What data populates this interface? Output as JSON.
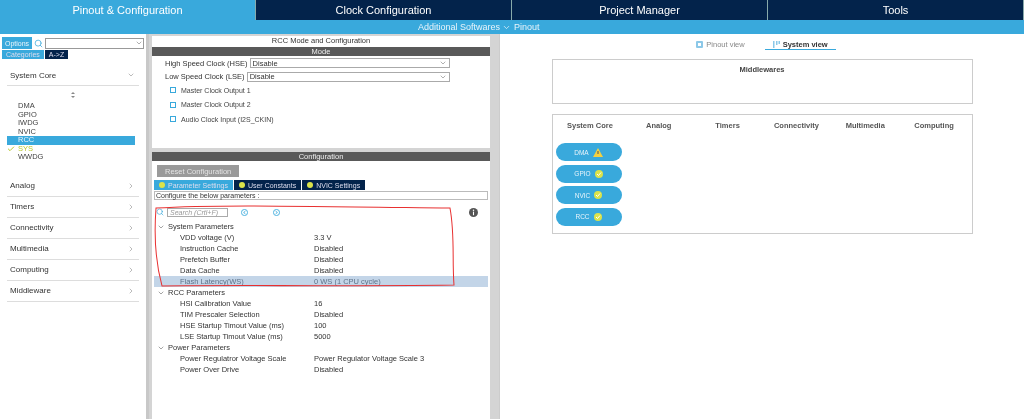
{
  "top_tabs": [
    {
      "label": "Pinout & Configuration",
      "selected": true
    },
    {
      "label": "Clock Configuration",
      "selected": false
    },
    {
      "label": "Project Manager",
      "selected": false
    },
    {
      "label": "Tools",
      "selected": false
    }
  ],
  "sub_bar": {
    "left": "Additional Softwares",
    "right": "Pinout"
  },
  "left_panel": {
    "options_button": "Options",
    "sort_tabs": [
      {
        "label": "Categories",
        "selected": true
      },
      {
        "label": "A->Z",
        "selected": false
      }
    ],
    "categories": [
      {
        "label": "System Core",
        "expanded": true,
        "items": [
          {
            "label": "DMA",
            "selected": false,
            "checked": false
          },
          {
            "label": "GPIO",
            "selected": false,
            "checked": false
          },
          {
            "label": "IWDG",
            "selected": false,
            "checked": false
          },
          {
            "label": "NVIC",
            "selected": false,
            "checked": false
          },
          {
            "label": "RCC",
            "selected": true,
            "checked": false
          },
          {
            "label": "SYS",
            "selected": false,
            "checked": true
          },
          {
            "label": "WWDG",
            "selected": false,
            "checked": false
          }
        ]
      },
      {
        "label": "Analog",
        "expanded": false
      },
      {
        "label": "Timers",
        "expanded": false
      },
      {
        "label": "Connectivity",
        "expanded": false
      },
      {
        "label": "Multimedia",
        "expanded": false
      },
      {
        "label": "Computing",
        "expanded": false
      },
      {
        "label": "Middleware",
        "expanded": false
      }
    ]
  },
  "middle_panel": {
    "title": "RCC Mode and Configuration",
    "mode": {
      "header": "Mode",
      "clocks": [
        {
          "label": "High Speed Clock (HSE)",
          "value": "Disable"
        },
        {
          "label": "Low Speed Clock (LSE)",
          "value": "Disable"
        }
      ],
      "options": [
        {
          "label": "Master Clock Output 1",
          "checked": false
        },
        {
          "label": "Master Clock Output 2",
          "checked": false
        },
        {
          "label": "Audio Clock Input (I2S_CKIN)",
          "checked": false
        }
      ]
    },
    "configuration": {
      "header": "Configuration",
      "reset_button": {
        "label": "Reset Configuration",
        "disabled": true
      },
      "tabs": [
        {
          "label": "Parameter Settings",
          "selected": true
        },
        {
          "label": "User Constants",
          "selected": false
        },
        {
          "label": "NVIC Settings",
          "selected": false
        }
      ],
      "info_text": "Configure the below parameters :",
      "search_placeholder": "Search (Crtl+F)",
      "groups": [
        {
          "label": "System Parameters",
          "expanded": true,
          "params": [
            {
              "name": "VDD voltage (V)",
              "value": "3.3 V",
              "selected": false,
              "disabled": false
            },
            {
              "name": "Instruction Cache",
              "value": "Disabled",
              "selected": false,
              "disabled": false
            },
            {
              "name": "Prefetch Buffer",
              "value": "Disabled",
              "selected": false,
              "disabled": false
            },
            {
              "name": "Data Cache",
              "value": "Disabled",
              "selected": false,
              "disabled": false
            },
            {
              "name": "Flash Latency(WS)",
              "value": "0 WS (1 CPU cycle)",
              "selected": true,
              "disabled": true
            }
          ]
        },
        {
          "label": "RCC Parameters",
          "expanded": true,
          "params": [
            {
              "name": "HSI Calibration Value",
              "value": "16",
              "selected": false,
              "disabled": false
            },
            {
              "name": "TIM Prescaler Selection",
              "value": "Disabled",
              "selected": false,
              "disabled": false
            },
            {
              "name": "HSE Startup Timout Value (ms)",
              "value": "100",
              "selected": false,
              "disabled": false
            },
            {
              "name": "LSE Startup Timout Value (ms)",
              "value": "5000",
              "selected": false,
              "disabled": false
            }
          ]
        },
        {
          "label": "Power Parameters",
          "expanded": true,
          "params": [
            {
              "name": "Power Regulatror Voltage Scale",
              "value": "Power Regulator Voltage Scale 3",
              "selected": false,
              "disabled": false
            },
            {
              "name": "Power Over Drive",
              "value": "Disabled",
              "selected": false,
              "disabled": false
            }
          ]
        }
      ]
    }
  },
  "right_panel": {
    "view_tabs": [
      {
        "label": "Pinout view",
        "selected": false
      },
      {
        "label": "System view",
        "selected": true
      }
    ],
    "middlewares": {
      "title": "Middlewares"
    },
    "system": {
      "columns": [
        "System Core",
        "Analog",
        "Timers",
        "Connectivity",
        "Multimedia",
        "Computing"
      ],
      "components": [
        {
          "label": "DMA",
          "warning": true
        },
        {
          "label": "GPIO",
          "warning": false
        },
        {
          "label": "NVIC",
          "warning": false
        },
        {
          "label": "RCC",
          "warning": false
        }
      ]
    }
  }
}
